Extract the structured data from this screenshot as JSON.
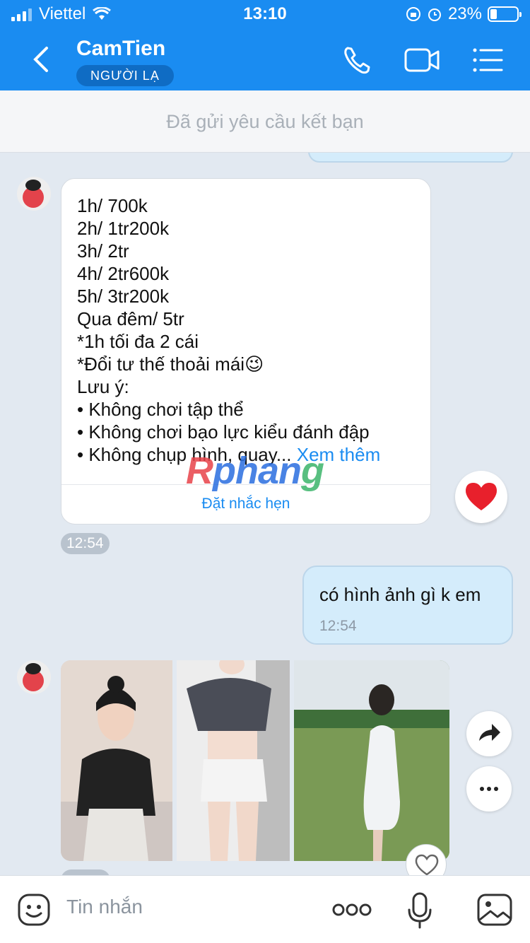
{
  "status_bar": {
    "carrier": "Viettel",
    "time": "13:10",
    "battery": "23%"
  },
  "header": {
    "contact_name": "CamTien",
    "badge": "NGƯỜI LẠ"
  },
  "friend_banner": "Đã gửi yêu cầu kết bạn",
  "received_message": {
    "text": "1h/ 700k\n2h/ 1tr200k\n3h/ 2tr\n4h/ 2tr600k\n5h/ 3tr200k\nQua đêm/ 5tr\n*1h tối đa 2 cái\n*Đổi tư thế thoải mái😉\nLưu ý:\n• Không chơi tập thể\n• Không chơi bạo lực kiểu đánh đập\n• Không chụp hình, quay...",
    "see_more": "Xem thêm",
    "reminder_action": "Đặt nhắc hẹn",
    "time": "12:54"
  },
  "watermark": {
    "part1": "R",
    "part2": "phan",
    "part3": "g"
  },
  "sent_message": {
    "text": "có hình ảnh gì k em",
    "time": "12:54"
  },
  "composer": {
    "placeholder": "Tin nhắn"
  },
  "colors": {
    "brand": "#1a8cf1",
    "sent_bubble": "#d4ecfb",
    "chat_bg": "#e2e9f1"
  }
}
